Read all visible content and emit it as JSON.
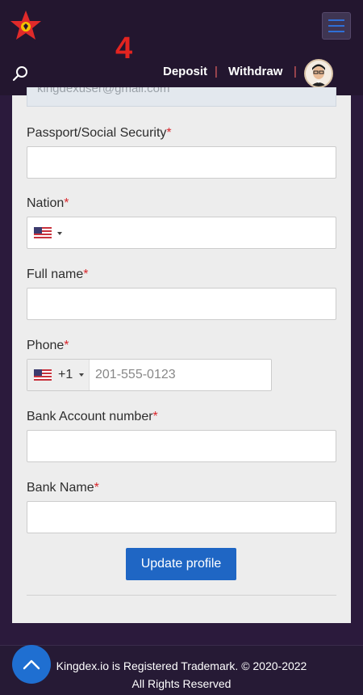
{
  "header": {
    "step_number": "4",
    "nav": {
      "deposit": "Deposit",
      "separator": "|",
      "withdraw": "Withdraw"
    },
    "icons": [
      "logo-star-icon",
      "hamburger-menu-icon",
      "search-icon",
      "user-avatar"
    ]
  },
  "form": {
    "email_value": "kingdexuser@gmail.com",
    "required_mark": "*",
    "fields": {
      "passport": {
        "label": "Passport/Social Security"
      },
      "nation": {
        "label": "Nation"
      },
      "full_name": {
        "label": "Full name"
      },
      "phone": {
        "label": "Phone",
        "dial_code": "+1",
        "placeholder": "201-555-0123"
      },
      "bank_account": {
        "label": "Bank Account number"
      },
      "bank_name": {
        "label": "Bank Name"
      }
    },
    "submit_label": "Update profile"
  },
  "footer": {
    "line1": "Kingdex.io is Registered Trademark. © 2020-2022",
    "line2": "All Rights Reserved"
  },
  "colors": {
    "background": "#2b1a3c",
    "accent_blue": "#1f66c4",
    "required_red": "#d9262c",
    "marker_red": "#e32420"
  }
}
